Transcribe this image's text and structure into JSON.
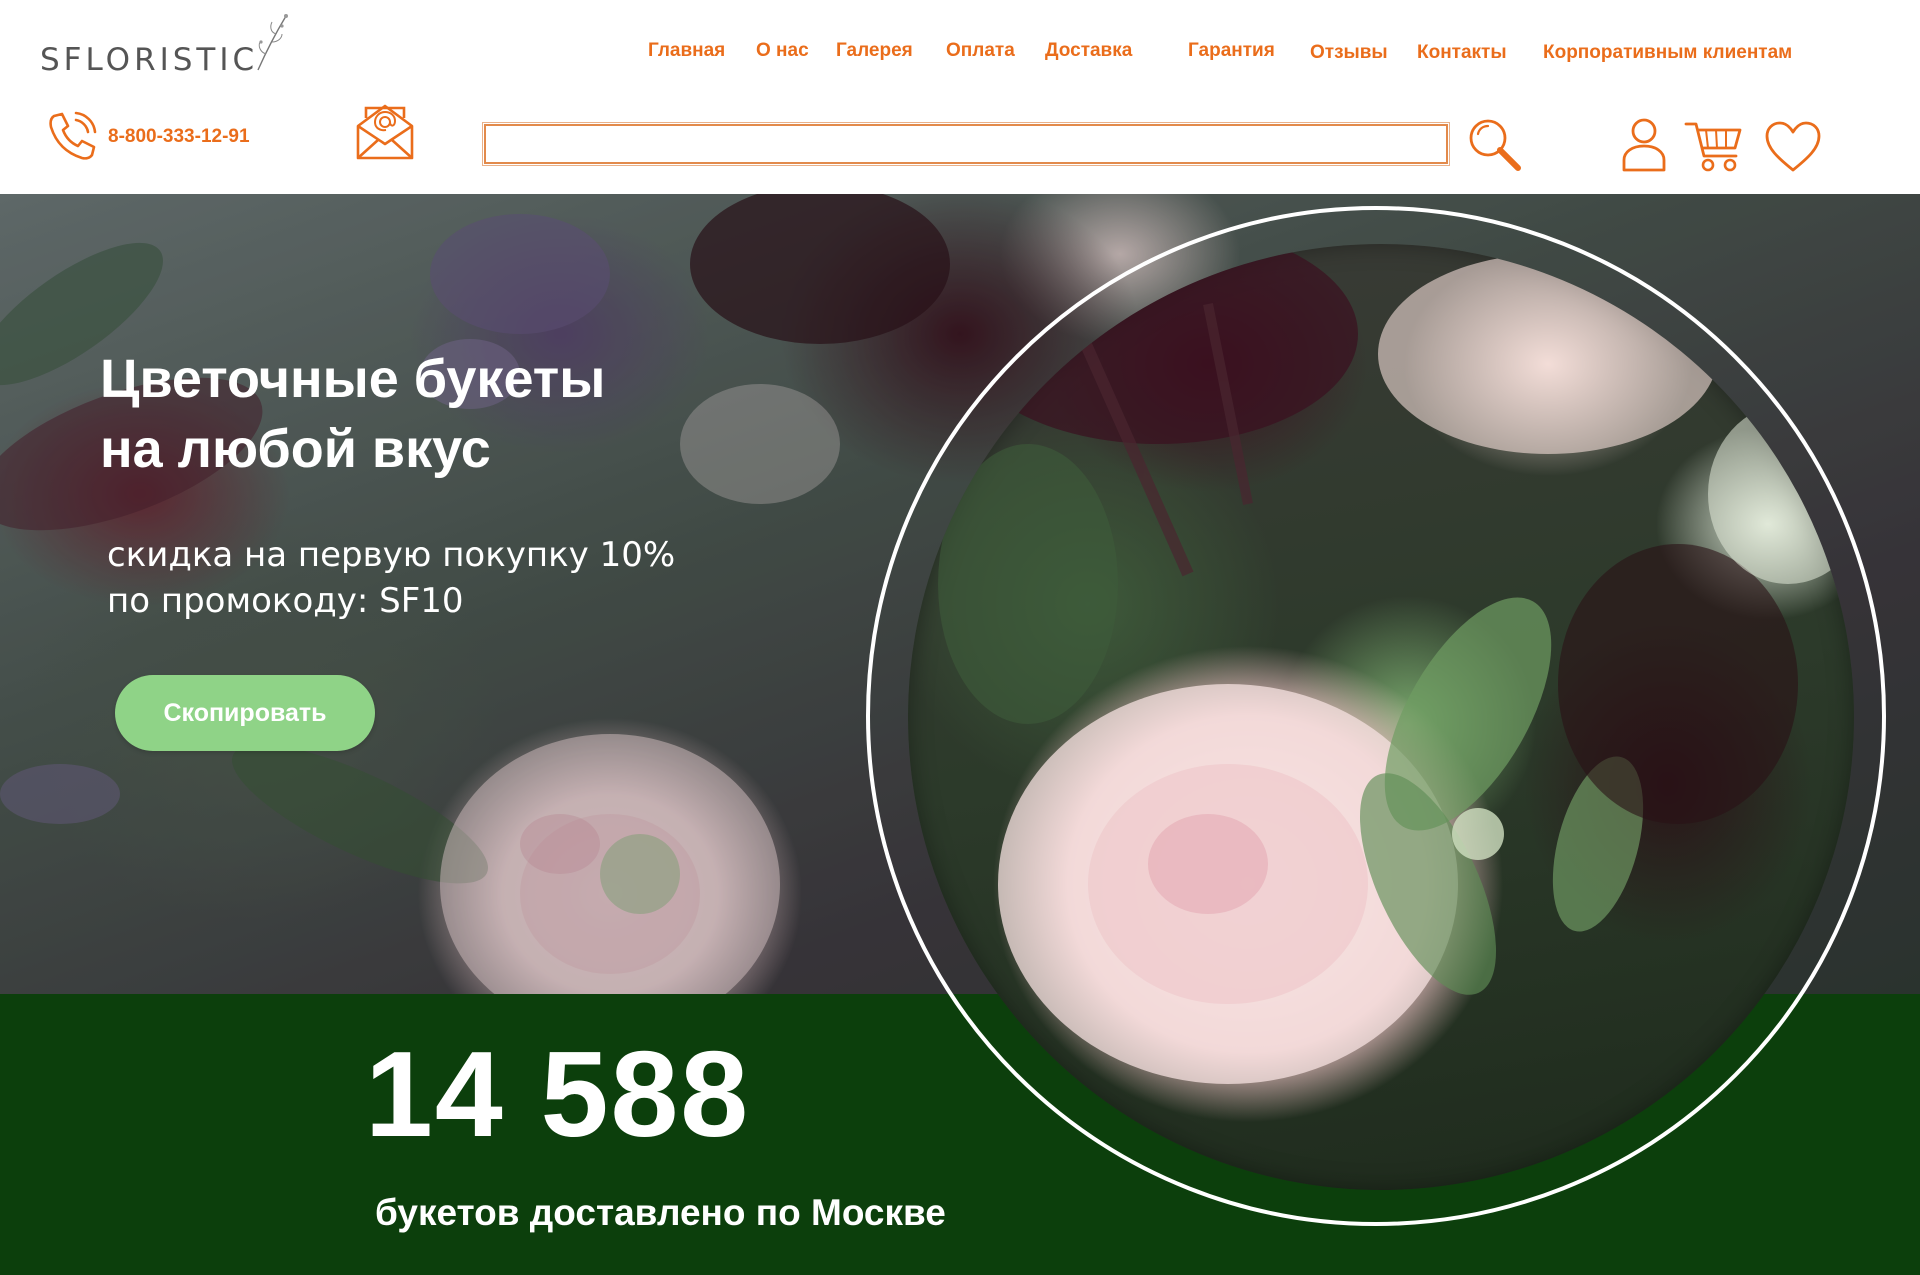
{
  "brand": {
    "logo_text": "SFLORISTIC",
    "accent_color": "#ea6d1b",
    "green_band_color": "#0c3f0c",
    "button_color": "#8fd387"
  },
  "nav": {
    "items": [
      {
        "label": "Главная"
      },
      {
        "label": "О нас"
      },
      {
        "label": "Галерея"
      },
      {
        "label": "Оплата"
      },
      {
        "label": "Доставка"
      },
      {
        "label": "Гарантия"
      },
      {
        "label": "Отзывы"
      },
      {
        "label": "Контакты"
      },
      {
        "label": "Корпоративным клиентам"
      }
    ]
  },
  "contact": {
    "phone": "8-800-333-12-91",
    "phone_icon": "phone-icon",
    "mail_icon": "mail-icon"
  },
  "search": {
    "value": "",
    "placeholder": "",
    "icon": "search-icon"
  },
  "header_icons": [
    "user-icon",
    "cart-icon",
    "heart-icon"
  ],
  "hero": {
    "title": "Цветочные букеты\nна любой вкус",
    "subtitle": "скидка на первую покупку 10%\nпо промокоду: SF10",
    "button_label": "Скопировать"
  },
  "stats": {
    "number": "14 588",
    "caption": "букетов доставлено по Москве"
  }
}
